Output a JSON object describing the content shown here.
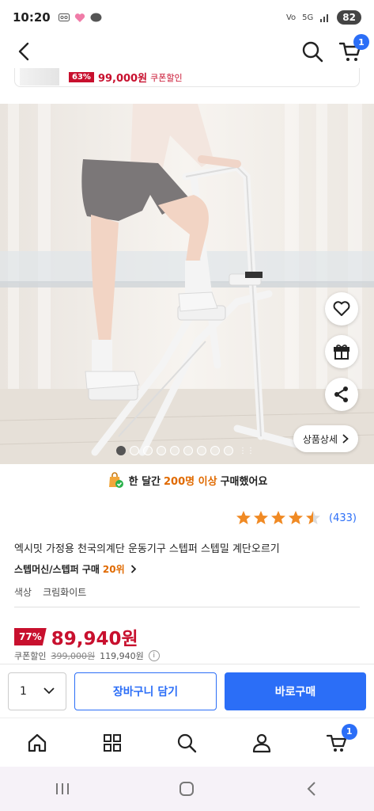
{
  "status_bar": {
    "time": "10:20",
    "network": "5G",
    "battery": "82"
  },
  "header": {
    "cart_badge": "1"
  },
  "mini_banner": {
    "discount": "63%",
    "price": "99,000원",
    "coupon": "쿠폰할인"
  },
  "gallery": {
    "dot_count": 9,
    "active_index": 0,
    "detail_label": "상품상세",
    "more_glyph": "⋮⋮"
  },
  "purchase_note": {
    "prefix": "한 달간",
    "highlight": "200명 이상",
    "suffix": "구매했어요"
  },
  "rating": {
    "stars": 4.5,
    "count": "(433)"
  },
  "product": {
    "title": "엑시밋 가정용 천국의계단 운동기구 스텝퍼 스텝밀 계단오르기",
    "rank_label": "스텝머신/스텝퍼 구매",
    "rank_value": "20위",
    "color_label": "색상",
    "color_value": "크림화이트"
  },
  "price": {
    "discount": "77%",
    "final": "89,940원",
    "coupon_label": "쿠폰할인",
    "original": "399,000원",
    "before_coupon": "119,940원"
  },
  "action_bar": {
    "quantity": "1",
    "cart_label": "장바구니 담기",
    "buy_label": "바로구매"
  },
  "bottom_nav": {
    "cart_badge": "1"
  },
  "colors": {
    "accent": "#2b6ef7",
    "price_red": "#c8102e",
    "highlight_orange": "#e06a00",
    "star": "#f08a24"
  }
}
